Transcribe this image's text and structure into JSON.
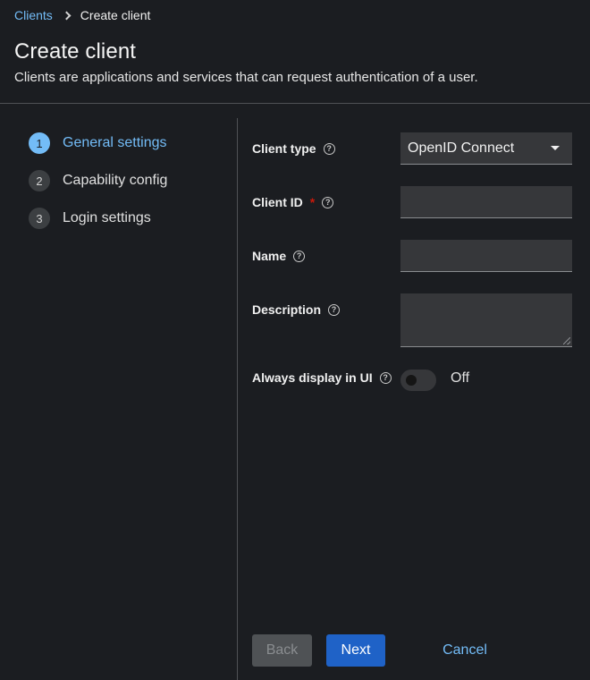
{
  "breadcrumb": {
    "parent": "Clients",
    "current": "Create client"
  },
  "header": {
    "title": "Create client",
    "subtitle": "Clients are applications and services that can request authentication of a user."
  },
  "wizard": {
    "steps": [
      {
        "number": "1",
        "label": "General settings",
        "active": true
      },
      {
        "number": "2",
        "label": "Capability config",
        "active": false
      },
      {
        "number": "3",
        "label": "Login settings",
        "active": false
      }
    ]
  },
  "form": {
    "client_type": {
      "label": "Client type",
      "value": "OpenID Connect"
    },
    "client_id": {
      "label": "Client ID",
      "required_mark": "*",
      "value": ""
    },
    "name": {
      "label": "Name",
      "value": ""
    },
    "description": {
      "label": "Description",
      "value": ""
    },
    "always_display": {
      "label": "Always display in UI",
      "state": "Off"
    },
    "help_glyph": "?"
  },
  "footer": {
    "back": "Back",
    "next": "Next",
    "cancel": "Cancel"
  },
  "colors": {
    "accent": "#73bcf7",
    "primary_button": "#1f62c7",
    "required": "#c9190b",
    "background": "#1b1d21"
  }
}
